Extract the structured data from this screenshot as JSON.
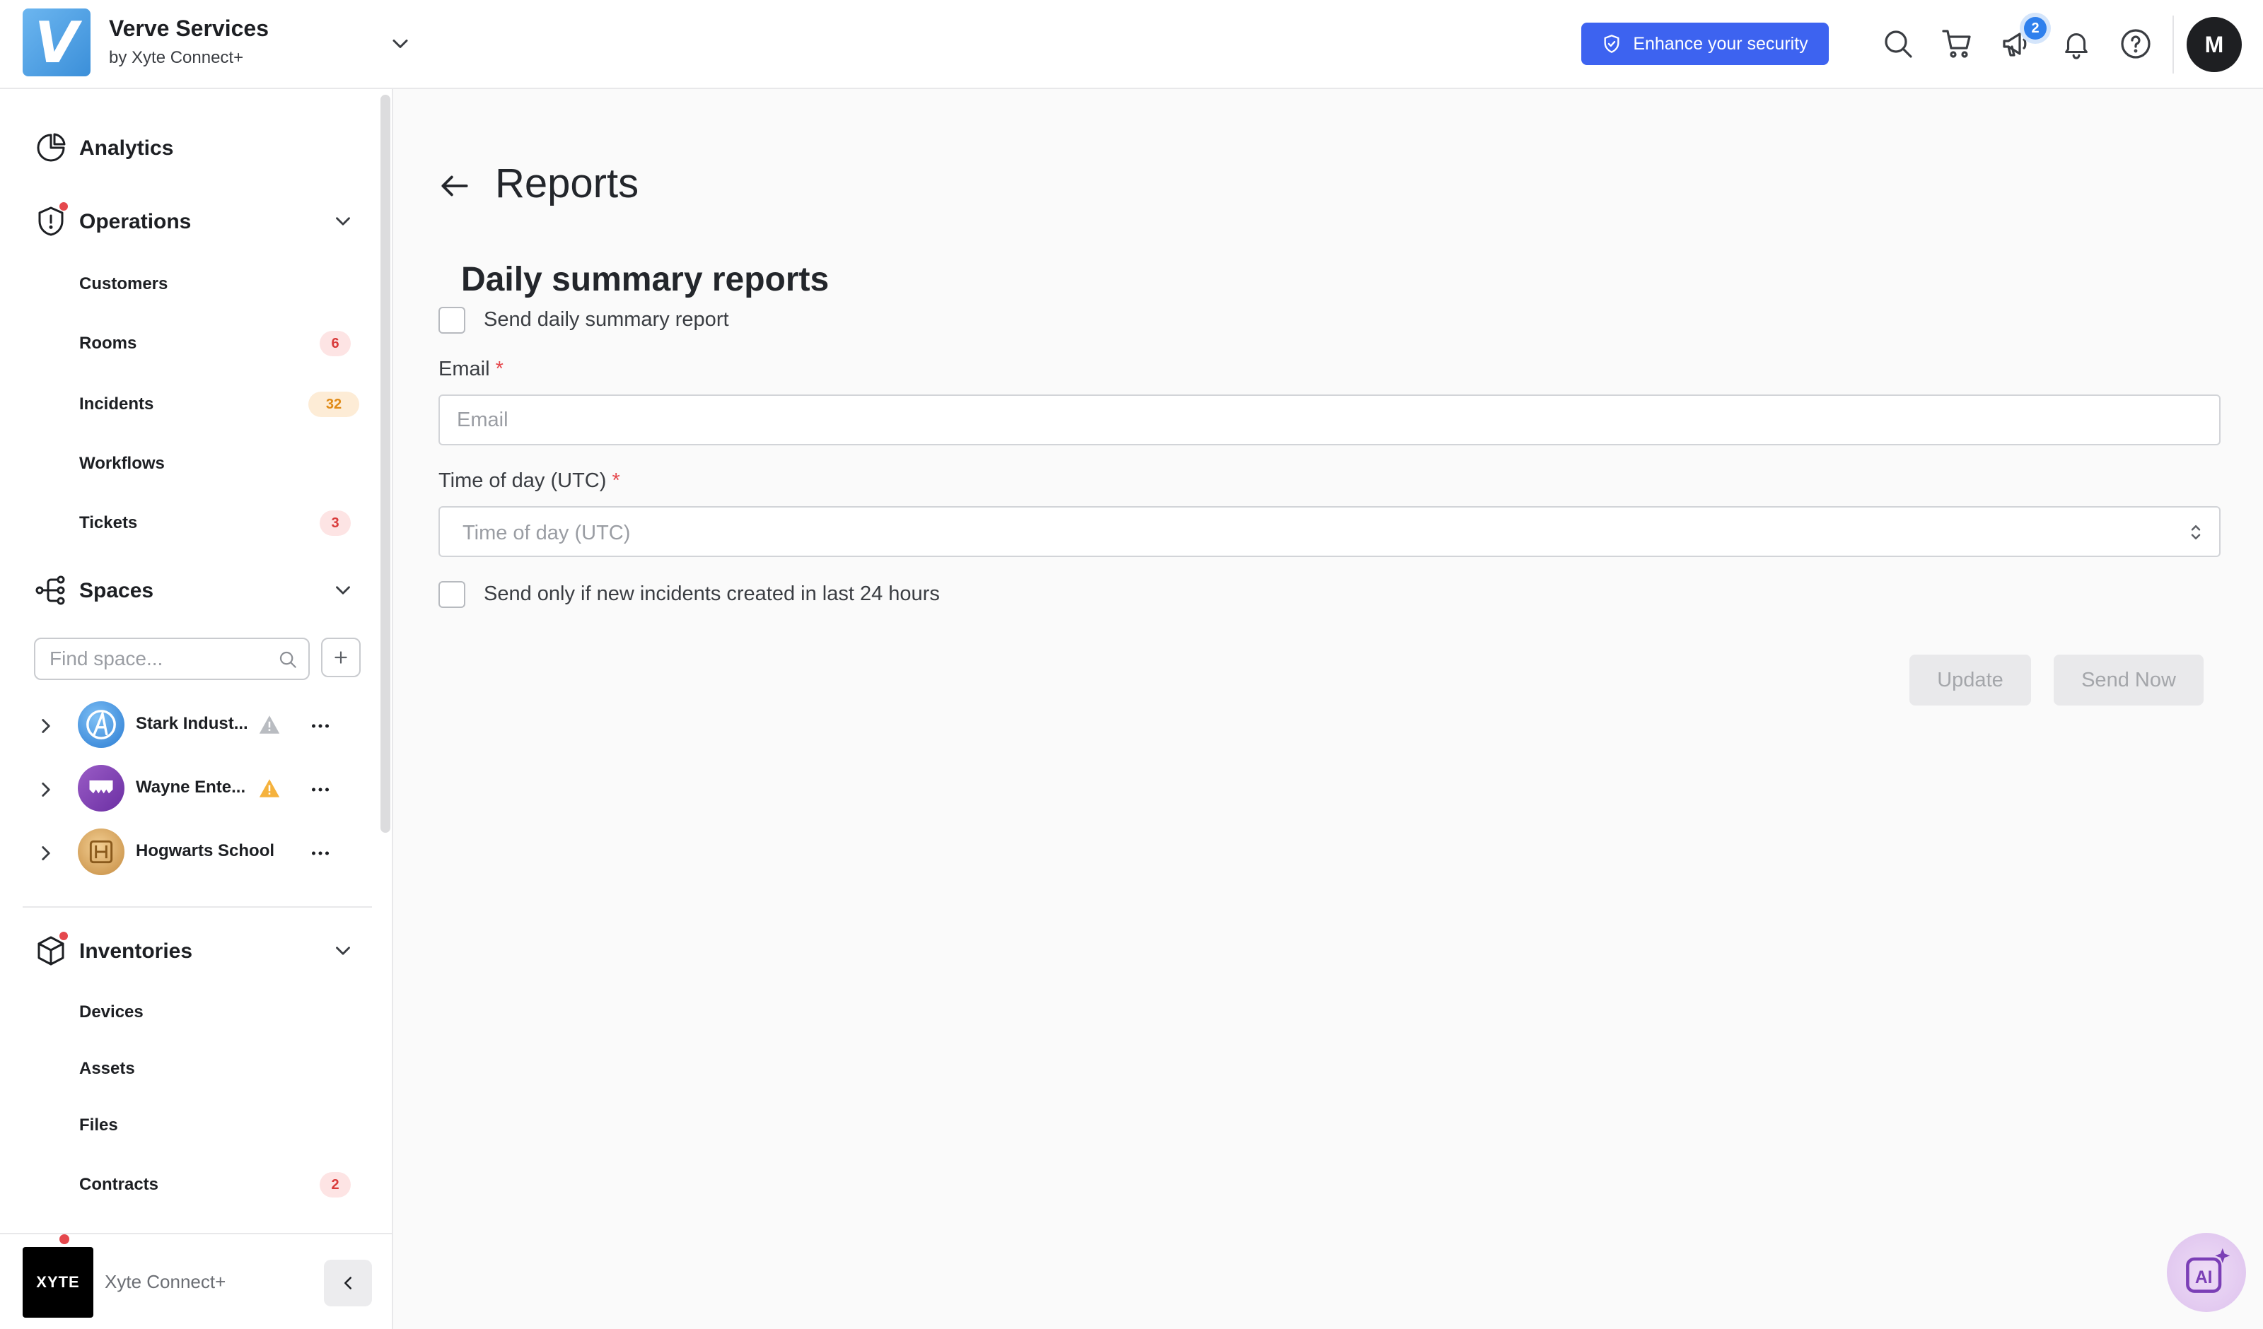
{
  "header": {
    "org_logo_letter": "V",
    "org_name": "Verve Services",
    "org_sub": "by Xyte Connect+",
    "security_label": "Enhance your security",
    "announcements_count": "2",
    "avatar_initial": "M"
  },
  "sidebar": {
    "analytics": "Analytics",
    "operations": {
      "label": "Operations",
      "items": [
        {
          "label": "Customers",
          "badge": ""
        },
        {
          "label": "Rooms",
          "badge": "6"
        },
        {
          "label": "Incidents",
          "badge": "32"
        },
        {
          "label": "Workflows",
          "badge": ""
        },
        {
          "label": "Tickets",
          "badge": "3"
        }
      ]
    },
    "spaces": {
      "label": "Spaces",
      "search_placeholder": "Find space...",
      "items": [
        {
          "name": "Stark Indust...",
          "warning": "grey"
        },
        {
          "name": "Wayne Ente...",
          "warning": "orange"
        },
        {
          "name": "Hogwarts School",
          "warning": ""
        }
      ]
    },
    "inventories": {
      "label": "Inventories",
      "items": [
        {
          "label": "Devices",
          "badge": ""
        },
        {
          "label": "Assets",
          "badge": ""
        },
        {
          "label": "Files",
          "badge": ""
        },
        {
          "label": "Contracts",
          "badge": "2"
        }
      ]
    },
    "footer": {
      "logo_text": "XYTE",
      "name": "Xyte Connect+"
    }
  },
  "main": {
    "page_title": "Reports",
    "section_title": "Daily summary reports",
    "send_daily_label": "Send daily summary report",
    "email_label": "Email",
    "email_placeholder": "Email",
    "time_label": "Time of day (UTC)",
    "time_placeholder": "Time of day (UTC)",
    "only_new_label": "Send only if new incidents created in last 24 hours",
    "update_label": "Update",
    "send_now_label": "Send Now",
    "required_mark": "*"
  },
  "ai_label": "AI",
  "colors": {
    "primary": "#3d63f0",
    "badge_red": "#d93b3b",
    "badge_orange": "#e08a16",
    "alert_dot": "#e5484d"
  },
  "icons": [
    "chevron-down-icon",
    "shield-check-icon",
    "search-icon",
    "cart-icon",
    "megaphone-icon",
    "bell-icon",
    "help-icon",
    "analytics-icon",
    "operations-alert-icon",
    "spaces-icon",
    "inventories-box-icon",
    "plus-icon",
    "warning-icon",
    "more-icon",
    "chevron-left-icon",
    "back-arrow-icon",
    "select-arrows-icon",
    "ai-sparkle-icon"
  ]
}
